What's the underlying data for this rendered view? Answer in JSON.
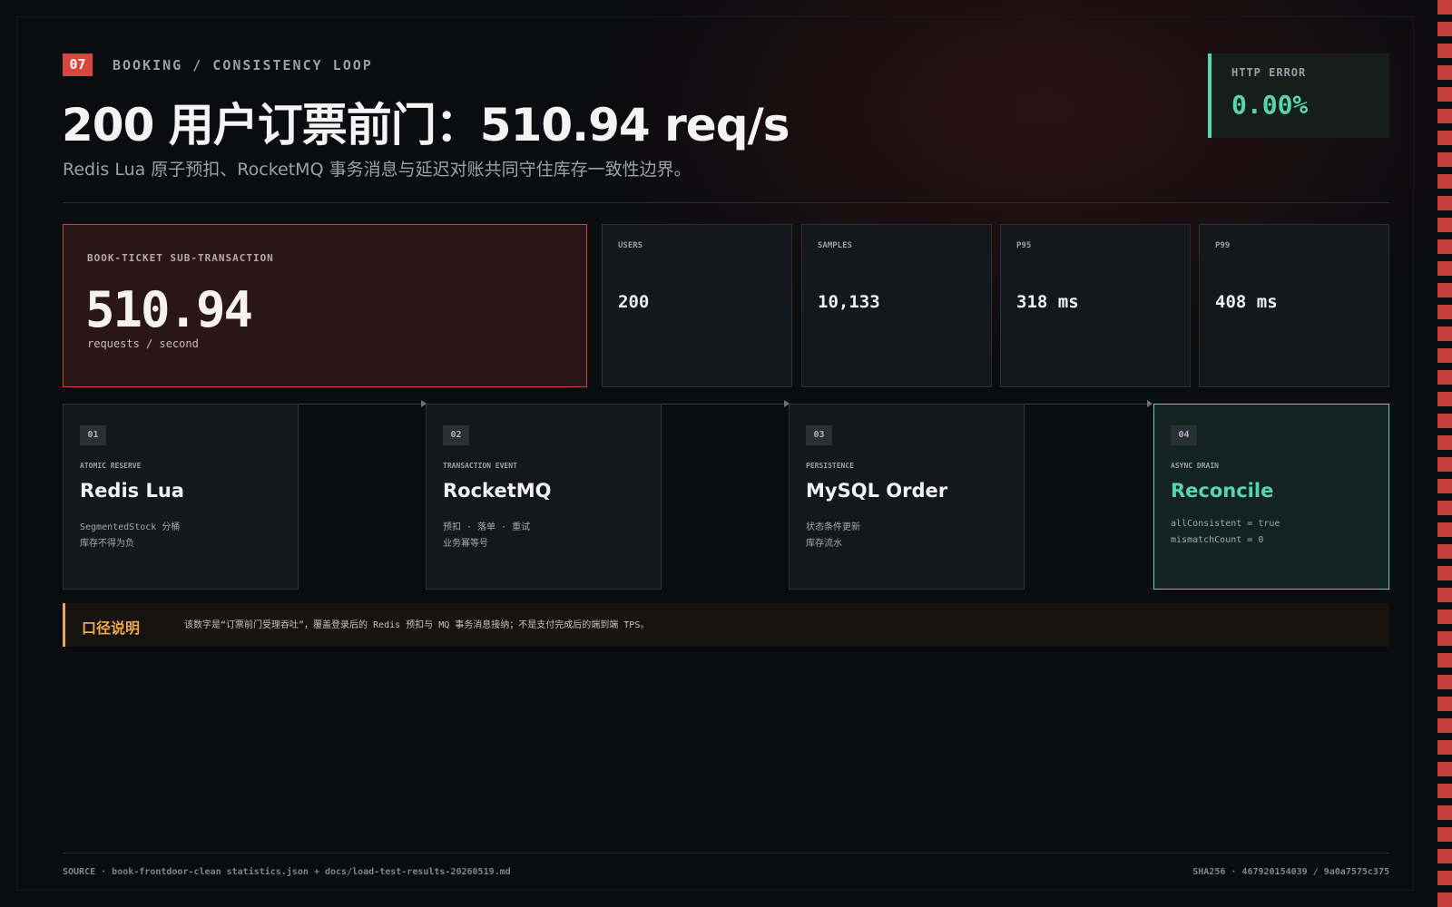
{
  "header": {
    "section_number": "07",
    "kicker": "BOOKING / CONSISTENCY LOOP",
    "title": "200 用户订票前门：510.94 req/s",
    "subtitle": "Redis Lua 原子预扣、RocketMQ 事务消息与延迟对账共同守住库存一致性边界。"
  },
  "error_badge": {
    "label": "HTTP ERROR",
    "value": "0.00%"
  },
  "hero": {
    "label": "BOOK-TICKET SUB-TRANSACTION",
    "value": "510.94",
    "unit": "requests / second"
  },
  "stats": [
    {
      "label": "USERS",
      "value": "200"
    },
    {
      "label": "SAMPLES",
      "value": "10,133"
    },
    {
      "label": "P95",
      "value": "318 ms"
    },
    {
      "label": "P99",
      "value": "408 ms"
    }
  ],
  "pipeline": [
    {
      "num": "01",
      "kicker": "ATOMIC RESERVE",
      "title": "Redis Lua",
      "lines": [
        "SegmentedStock 分桶",
        "库存不得为负"
      ]
    },
    {
      "num": "02",
      "kicker": "TRANSACTION EVENT",
      "title": "RocketMQ",
      "lines": [
        "预扣 · 落单 · 重试",
        "业务幂等号"
      ]
    },
    {
      "num": "03",
      "kicker": "PERSISTENCE",
      "title": "MySQL Order",
      "lines": [
        "状态条件更新",
        "库存流水"
      ]
    },
    {
      "num": "04",
      "kicker": "ASYNC DRAIN",
      "title": "Reconcile",
      "lines": [
        "allConsistent = true",
        "mismatchCount = 0"
      ]
    }
  ],
  "note": {
    "label": "口径说明",
    "text": "该数字是“订票前门受理吞吐”，覆盖登录后的 Redis 预扣与 MQ 事务消息接纳；不是支付完成后的端到端 TPS。"
  },
  "footer": {
    "source": "SOURCE · book-frontdoor-clean statistics.json + docs/load-test-results-20260519.md",
    "hash": "SHA256 · 467920154039 / 9a0a7575c375"
  },
  "colors": {
    "accent_red": "#d9463d",
    "accent_green": "#56d6ac",
    "accent_amber": "#f0a94a"
  }
}
